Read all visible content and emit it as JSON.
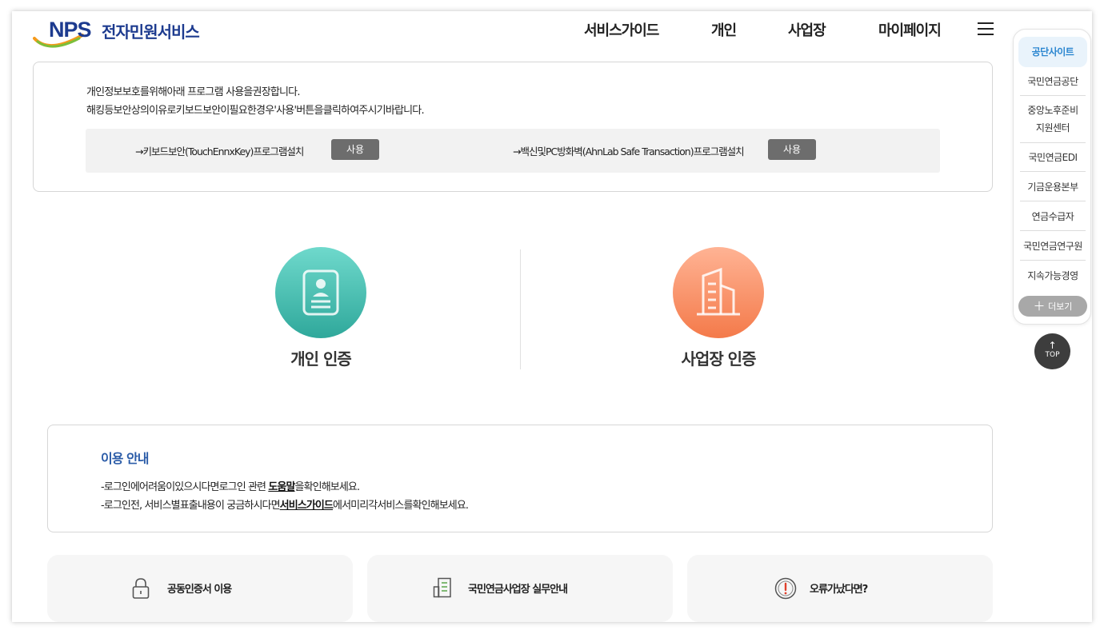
{
  "header": {
    "logo_text": "NPS",
    "service_title": "전자민원서비스",
    "nav": [
      "서비스가이드",
      "개인",
      "사업장",
      "마이페이지"
    ]
  },
  "security": {
    "line1": "개인정보보호를위해아래 프로그램 사용을권장합니다.",
    "line2": "해킹등보안상의이유로키보드보안이필요한경우'사용'버튼을클릭하여주시기바랍니다.",
    "programs": [
      {
        "label": "→키보드보안(TouchEnnxKey)프로그램설치",
        "button": "사용"
      },
      {
        "label": "→백신및PC방화벽(AhnLab Safe Transaction)프로그램설치",
        "button": "사용"
      }
    ]
  },
  "auth": {
    "personal": "개인 인증",
    "business": "사업장 인증"
  },
  "guide": {
    "title": "이용 안내",
    "line1_pre": "-로그인에어려움이있으시다면로그인 관련 ",
    "line1_link": "도움말",
    "line1_post": "을확인해보세요.",
    "line2_pre": "-로그인전, 서비스별표출내용이 궁금하시다면",
    "line2_link": "서비스가이드",
    "line2_post": "에서미리각서비스를확인해보세요."
  },
  "cards": [
    {
      "label": "공동인증서 이용",
      "icon": "lock-icon"
    },
    {
      "label": "국민연금사업장 실무안내",
      "icon": "document-icon"
    },
    {
      "label": "오류가났다면?",
      "icon": "alert-icon"
    }
  ],
  "quick_panel": {
    "title": "공단사이트",
    "items": [
      "국민연금공단",
      "중앙노후준비",
      "지원센터",
      "국민연금EDI",
      "기금운용본부",
      "연금수급자",
      "국민연금연구원",
      "지속가능경영"
    ],
    "more": "더보기",
    "top": "TOP"
  },
  "colors": {
    "brand_navy": "#1d3b8f",
    "teal": "#3bbfb0",
    "orange": "#f58a5e",
    "guide_blue": "#2b5ca8",
    "quick_blue": "#2b86d0"
  }
}
